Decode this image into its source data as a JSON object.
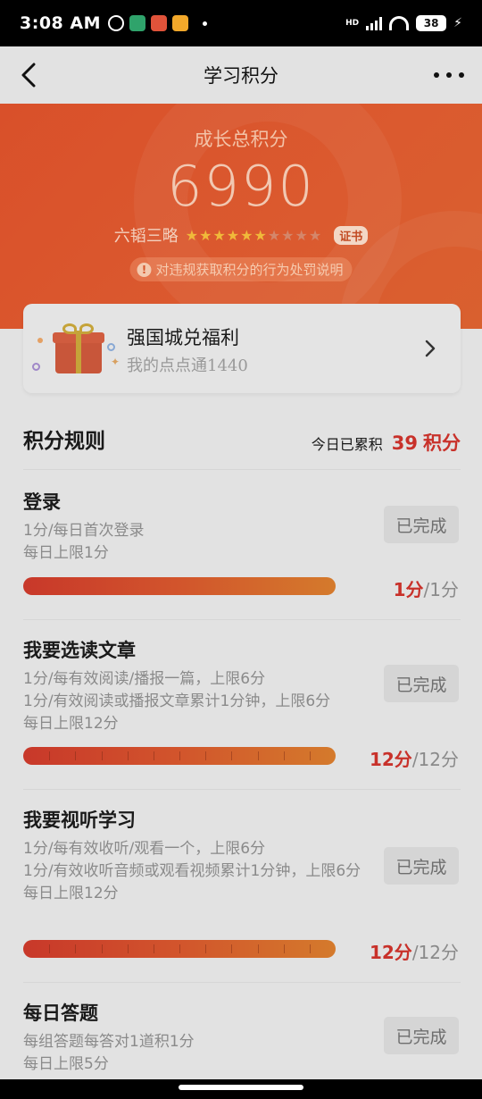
{
  "status_bar": {
    "time": "3:08 AM",
    "battery": "38",
    "network": "HD"
  },
  "header": {
    "title": "学习积分",
    "back_icon": "chevron-left-icon",
    "more_icon": "more-dots-icon"
  },
  "hero": {
    "label": "成长总积分",
    "total": "6990",
    "level_name": "六韬三略",
    "stars_filled": 6,
    "stars_total": 10,
    "certificate_label": "证书",
    "violation_note": "对违规获取积分的行为处罚说明",
    "color": "#d9532b"
  },
  "welfare": {
    "title": "强国城兑福利",
    "subtitle": "我的点点通1440"
  },
  "rules": {
    "title": "积分规则",
    "today_label": "今日已累积",
    "today_points": "39",
    "today_unit": "积分"
  },
  "tasks": [
    {
      "title": "登录",
      "desc": [
        "1分/每日首次登录",
        "每日上限1分"
      ],
      "status": "已完成",
      "score_got": "1分",
      "score_total": "/1分",
      "progress": 1.0,
      "segments": 1
    },
    {
      "title": "我要选读文章",
      "desc": [
        "1分/每有效阅读/播报一篇，上限6分",
        "1分/有效阅读或播报文章累计1分钟，上限6分",
        "每日上限12分"
      ],
      "status": "已完成",
      "score_got": "12分",
      "score_total": "/12分",
      "progress": 1.0,
      "segments": 12
    },
    {
      "title": "我要视听学习",
      "desc": [
        "1分/每有效收听/观看一个，上限6分",
        "1分/有效收听音频或观看视频累计1分钟，上限6分",
        "每日上限12分"
      ],
      "status": "已完成",
      "score_got": "12分",
      "score_total": "/12分",
      "progress": 1.0,
      "segments": 12
    },
    {
      "title": "每日答题",
      "desc": [
        "每组答题每答对1道积1分",
        "每日上限5分"
      ],
      "status": "已完成"
    }
  ],
  "colors": {
    "accent_red": "#c8312a",
    "bar_start": "#c8382a",
    "bar_end": "#d47a2c"
  }
}
